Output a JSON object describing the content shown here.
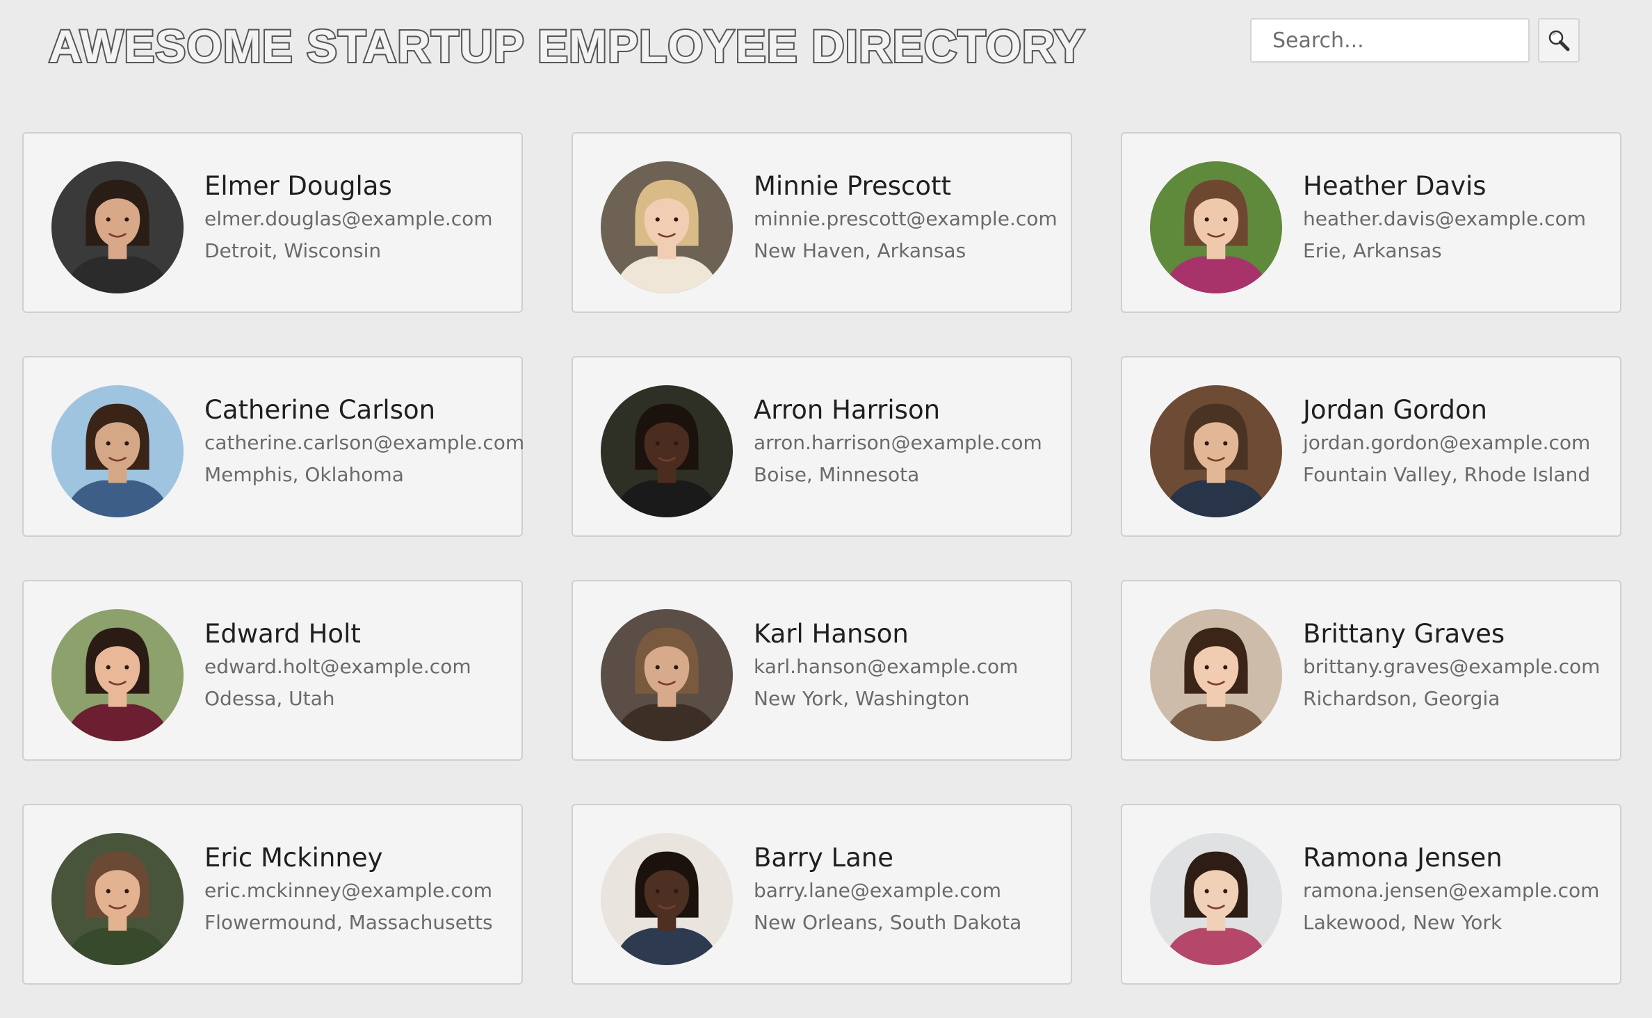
{
  "header": {
    "title": "AWESOME STARTUP EMPLOYEE DIRECTORY",
    "search_placeholder": "Search...",
    "search_icon": "magnifier-icon"
  },
  "employees": [
    {
      "name": "Elmer Douglas",
      "email": "elmer.douglas@example.com",
      "location": "Detroit, Wisconsin",
      "skin": "#d9a888",
      "hair": "#2a1d16",
      "bg": "#3a3a3a",
      "shirt": "#2b2b2b"
    },
    {
      "name": "Minnie Prescott",
      "email": "minnie.prescott@example.com",
      "location": "New Haven, Arkansas",
      "skin": "#f1cdb3",
      "hair": "#d8bb86",
      "bg": "#6d6253",
      "shirt": "#efe6d8"
    },
    {
      "name": "Heather Davis",
      "email": "heather.davis@example.com",
      "location": "Erie, Arkansas",
      "skin": "#f0c9ad",
      "hair": "#6e4731",
      "bg": "#5f8a3c",
      "shirt": "#a8326a"
    },
    {
      "name": "Catherine Carlson",
      "email": "catherine.carlson@example.com",
      "location": "Memphis, Oklahoma",
      "skin": "#d4a887",
      "hair": "#3a2418",
      "bg": "#9fc4e0",
      "shirt": "#3d5f87"
    },
    {
      "name": "Arron Harrison",
      "email": "arron.harrison@example.com",
      "location": "Boise, Minnesota",
      "skin": "#4a2d1f",
      "hair": "#1b120d",
      "bg": "#2e3026",
      "shirt": "#1a1a1a"
    },
    {
      "name": "Jordan Gordon",
      "email": "jordan.gordon@example.com",
      "location": "Fountain Valley, Rhode Island",
      "skin": "#e2b795",
      "hair": "#4a3323",
      "bg": "#6e4b34",
      "shirt": "#283447"
    },
    {
      "name": "Edward Holt",
      "email": "edward.holt@example.com",
      "location": "Odessa, Utah",
      "skin": "#e8b899",
      "hair": "#2a1c14",
      "bg": "#8da16d",
      "shirt": "#6b1f30"
    },
    {
      "name": "Karl Hanson",
      "email": "karl.hanson@example.com",
      "location": "New York, Washington",
      "skin": "#d8aa8c",
      "hair": "#7a5a3e",
      "bg": "#5a4e47",
      "shirt": "#3c3026"
    },
    {
      "name": "Brittany Graves",
      "email": "brittany.graves@example.com",
      "location": "Richardson, Georgia",
      "skin": "#f2ccb0",
      "hair": "#3b2519",
      "bg": "#cdbca9",
      "shirt": "#7a5d47"
    },
    {
      "name": "Eric Mckinney",
      "email": "eric.mckinney@example.com",
      "location": "Flowermound, Massachusetts",
      "skin": "#e3b290",
      "hair": "#6a4a35",
      "bg": "#48553b",
      "shirt": "#374a2c"
    },
    {
      "name": "Barry Lane",
      "email": "barry.lane@example.com",
      "location": "New Orleans, South Dakota",
      "skin": "#4d3022",
      "hair": "#1b120d",
      "bg": "#e9e4de",
      "shirt": "#2d3a50"
    },
    {
      "name": "Ramona Jensen",
      "email": "ramona.jensen@example.com",
      "location": "Lakewood, New York",
      "skin": "#f1d0b8",
      "hair": "#2e1d14",
      "bg": "#dfe1e3",
      "shirt": "#b5486a"
    }
  ]
}
